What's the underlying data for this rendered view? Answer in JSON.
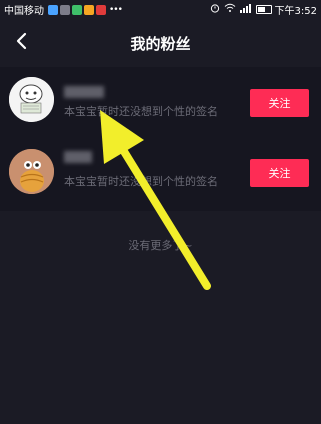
{
  "status_bar": {
    "carrier": "中国移动",
    "time": "下午3:52",
    "battery_level": 0.55
  },
  "nav": {
    "title": "我的粉丝"
  },
  "followers": [
    {
      "signature": "本宝宝暂时还没想到个性的签名",
      "follow_label": "关注"
    },
    {
      "signature": "本宝宝暂时还没想到个性的签名",
      "follow_label": "关注"
    }
  ],
  "footer": {
    "no_more_text": "没有更多了~"
  },
  "colors": {
    "background": "#1b1b25",
    "list_background": "#161620",
    "follow_button": "#fe2c55",
    "annotation_arrow": "#f2ee2b",
    "muted_text": "#6b6b76"
  }
}
